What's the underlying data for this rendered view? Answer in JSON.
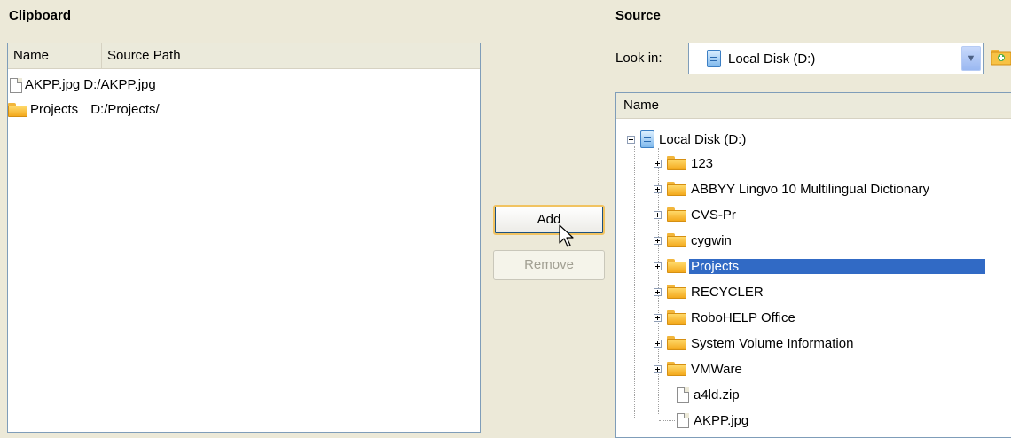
{
  "clipboard": {
    "title": "Clipboard",
    "columns": [
      "Name",
      "Source Path"
    ],
    "rows": [
      {
        "name": "AKPP.jpg",
        "path": "D:/AKPP.jpg",
        "icon": "file-icon"
      },
      {
        "name": "Projects",
        "path": "D:/Projects/",
        "icon": "folder-icon"
      }
    ]
  },
  "actions": {
    "add_label": "Add",
    "remove_label": "Remove"
  },
  "source": {
    "title": "Source",
    "look_in_label": "Look in:",
    "look_in_value": "Local Disk (D:)",
    "tree_header": "Name",
    "root": "Local Disk (D:)",
    "items": [
      {
        "label": "123",
        "type": "folder"
      },
      {
        "label": "ABBYY Lingvo 10 Multilingual Dictionary",
        "type": "folder"
      },
      {
        "label": "CVS-Pr",
        "type": "folder"
      },
      {
        "label": "cygwin",
        "type": "folder"
      },
      {
        "label": "Projects",
        "type": "folder",
        "selected": true
      },
      {
        "label": "RECYCLER",
        "type": "folder"
      },
      {
        "label": "RoboHELP Office",
        "type": "folder"
      },
      {
        "label": "System Volume Information",
        "type": "folder"
      },
      {
        "label": "VMWare",
        "type": "folder"
      },
      {
        "label": "a4ld.zip",
        "type": "file"
      },
      {
        "label": "AKPP.jpg",
        "type": "file"
      }
    ]
  },
  "colors": {
    "dialog_bg": "#ece9d8",
    "selection": "#316ac5",
    "button_focus": "#f1c361"
  }
}
